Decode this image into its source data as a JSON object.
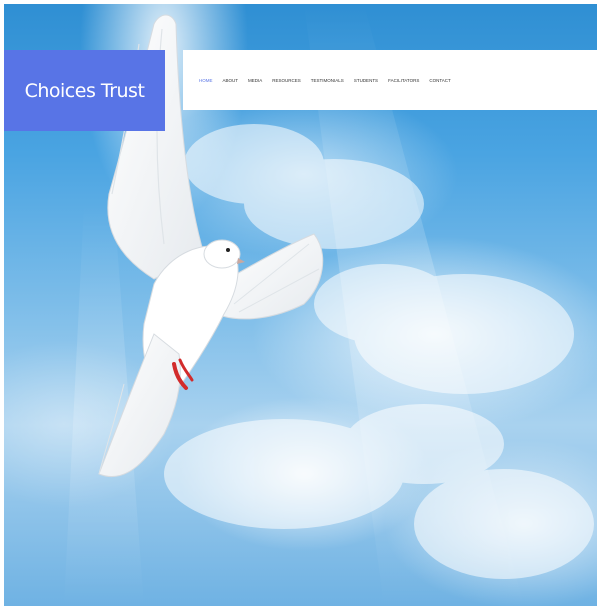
{
  "brand": {
    "title": "Choices Trust",
    "color": "#5874e6"
  },
  "nav": {
    "items": [
      {
        "label": "HOME",
        "active": true
      },
      {
        "label": "ABOUT",
        "active": false
      },
      {
        "label": "MEDIA",
        "active": false
      },
      {
        "label": "RESOURCES",
        "active": false
      },
      {
        "label": "TESTIMONIALS",
        "active": false
      },
      {
        "label": "STUDENTS",
        "active": false
      },
      {
        "label": "FACILITATORS",
        "active": false
      },
      {
        "label": "CONTACT",
        "active": false
      }
    ]
  },
  "hero": {
    "image": "dove-in-sky-image",
    "sky_color": "#4aa4e2"
  }
}
